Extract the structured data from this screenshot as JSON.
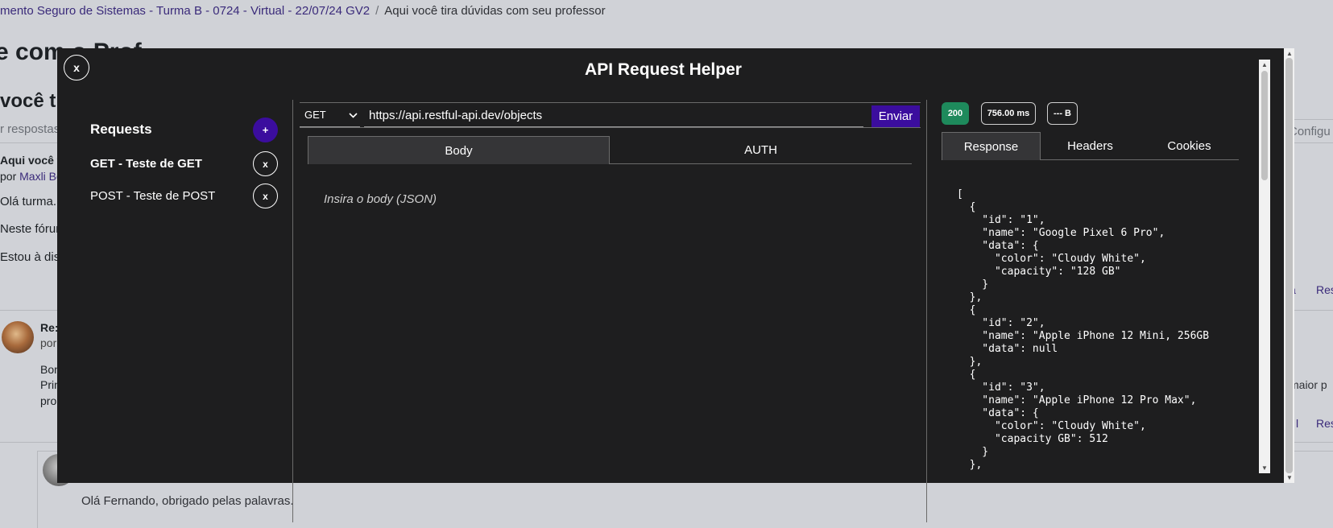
{
  "background": {
    "breadcrumb": {
      "course": "mento Seguro de Sistemas - Turma B - 0724 - Virtual - 22/07/24 GV2",
      "separator": "/",
      "current": "Aqui você tira dúvidas com seu professor"
    },
    "page_title": "e com o Prof",
    "subtitle": "você t",
    "search_placeholder": "r respostas",
    "config_label": "Configu",
    "post": {
      "title": "Aqui você t",
      "by_prefix": "por ",
      "author": "Maxli Bo",
      "greeting": "Olá turma.",
      "line1": "Neste fórun",
      "line2": "Estou à disp"
    },
    "reply": {
      "re": "Re:",
      "por": "por",
      "line1": "Bon",
      "line2": "Prin",
      "line3": "pro",
      "right_link1": "a",
      "right_link2": "Res",
      "right_text": "maior p",
      "right_link3": "l",
      "right_link4": "Res"
    },
    "nested_reply_text": "Olá Fernando, obrigado pelas palavras."
  },
  "modal": {
    "close_label": "x",
    "title": "API Request Helper",
    "sidebar": {
      "heading": "Requests",
      "add_label": "+",
      "items": [
        {
          "label": "GET - Teste de GET",
          "delete_label": "x"
        },
        {
          "label": "POST - Teste de POST",
          "delete_label": "x"
        }
      ]
    },
    "request": {
      "method": "GET",
      "url": "https://api.restful-api.dev/objects",
      "send_label": "Enviar",
      "tabs": [
        "Body",
        "AUTH"
      ],
      "active_tab": "Body",
      "body_placeholder": "Insira o body (JSON)"
    },
    "response": {
      "status": "200",
      "time": "756.00 ms",
      "size": "--- B",
      "tabs": [
        "Response",
        "Headers",
        "Cookies"
      ],
      "active_tab": "Response",
      "body": "[\n  {\n    \"id\": \"1\",\n    \"name\": \"Google Pixel 6 Pro\",\n    \"data\": {\n      \"color\": \"Cloudy White\",\n      \"capacity\": \"128 GB\"\n    }\n  },\n  {\n    \"id\": \"2\",\n    \"name\": \"Apple iPhone 12 Mini, 256GB\n    \"data\": null\n  },\n  {\n    \"id\": \"3\",\n    \"name\": \"Apple iPhone 12 Pro Max\",\n    \"data\": {\n      \"color\": \"Cloudy White\",\n      \"capacity GB\": 512\n    }\n  },"
    },
    "colors": {
      "modal_bg": "#1e1e1f",
      "accent": "#3b0d9e",
      "status_ok": "#1e8a5c",
      "active_tab_bg": "#353537"
    },
    "icons": {
      "method_dropdown": "chevron-down-icon",
      "scroll_up": "triangle-up-icon",
      "scroll_down": "triangle-down-icon"
    }
  }
}
